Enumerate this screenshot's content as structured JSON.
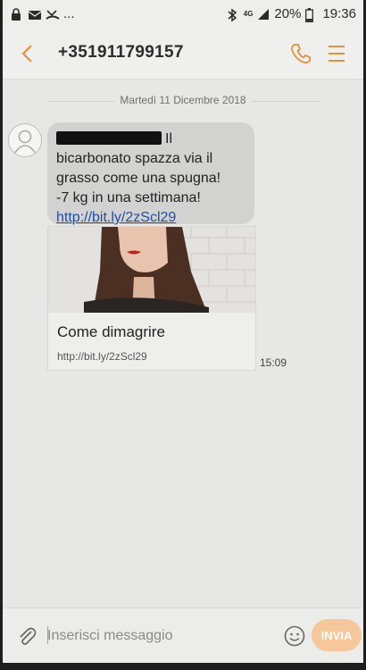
{
  "status_bar": {
    "network_label": "4G",
    "battery_percent": "20%",
    "time": "19:36",
    "notification_more": "...",
    "icons": [
      "lock-icon",
      "mail-icon",
      "missed-call-icon",
      "bluetooth-icon",
      "signal-icon",
      "battery-icon"
    ]
  },
  "header": {
    "title": "+351911799157",
    "icons": [
      "back-arrow-icon",
      "phone-icon",
      "menu-icon"
    ]
  },
  "conversation": {
    "date_separator": "Martedì 11 Dicembre 2018",
    "message": {
      "lines": [
        "Il",
        "bicarbonato spazza via il",
        "grasso come una spugna!",
        "-7 kg in una settimana!"
      ],
      "link": "http://bit.ly/2zScl29",
      "time": "15:09"
    },
    "link_preview": {
      "title": "Come dimagrire",
      "url": "http://bit.ly/2zScl29"
    }
  },
  "composer": {
    "placeholder": "Inserisci messaggio",
    "send_label": "INVIA"
  },
  "colors": {
    "accent": "#e8903b",
    "bubble": "#d2d2d0",
    "background": "#e7e7e5",
    "link": "#1f4fa8"
  }
}
